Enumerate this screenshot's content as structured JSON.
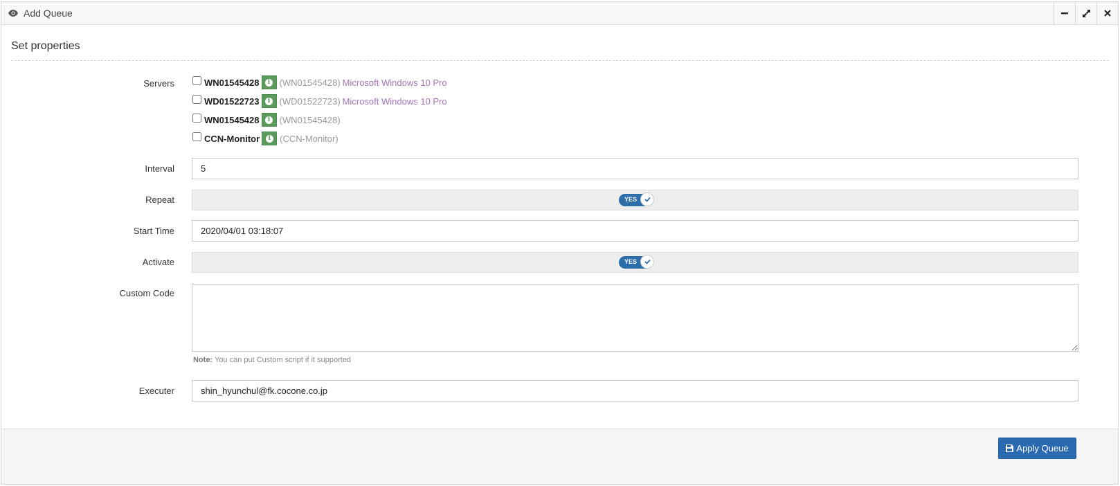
{
  "window": {
    "title": "Add Queue",
    "icon": "eye-icon",
    "controls": [
      "minimize-icon",
      "expand-icon",
      "close-icon"
    ]
  },
  "section": {
    "title": "Set properties"
  },
  "labels": {
    "servers": "Servers",
    "interval": "Interval",
    "repeat": "Repeat",
    "start_time": "Start Time",
    "activate": "Activate",
    "custom_code": "Custom Code",
    "executer": "Executer"
  },
  "servers": [
    {
      "name": "WN01545428",
      "id": "(WN01545428)",
      "os": "Microsoft Windows 10 Pro",
      "checked": false
    },
    {
      "name": "WD01522723",
      "id": "(WD01522723)",
      "os": "Microsoft Windows 10 Pro",
      "checked": false
    },
    {
      "name": "WN01545428",
      "id": "(WN01545428)",
      "os": "",
      "checked": false
    },
    {
      "name": "CCN-Monitor",
      "id": "(CCN-Monitor)",
      "os": "",
      "checked": false
    }
  ],
  "fields": {
    "interval": "5",
    "repeat": "YES",
    "start_time": "2020/04/01 03:18:07",
    "activate": "YES",
    "custom_code": "",
    "executer": "shin_hyunchul@fk.cocone.co.jp"
  },
  "note": {
    "prefix": "Note:",
    "text": " You can put Custom script if it supported"
  },
  "footer": {
    "apply_label": "Apply Queue"
  },
  "colors": {
    "primary": "#2a6ab0",
    "info_green": "#5b9a5b",
    "os_purple": "#a674b8"
  }
}
